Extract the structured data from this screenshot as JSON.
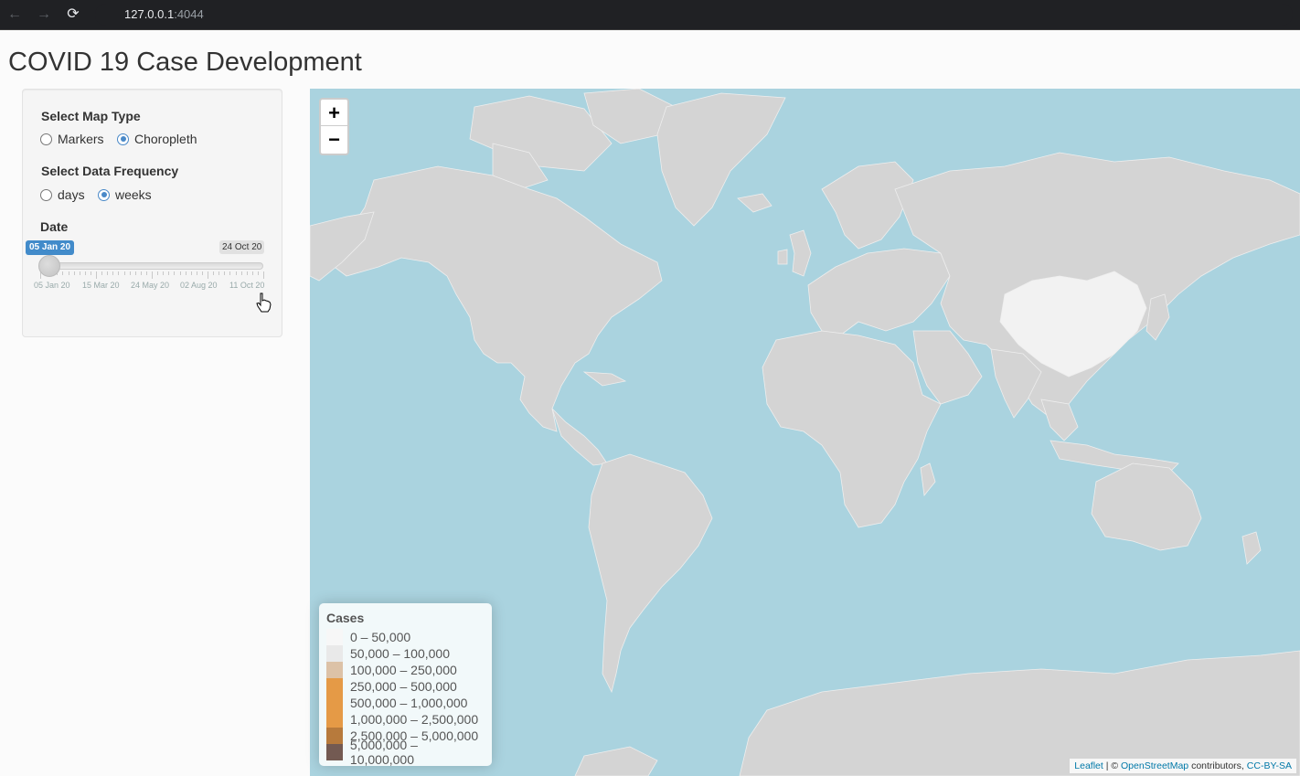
{
  "browser": {
    "url_host": "127.0.0.1",
    "url_port": ":4044"
  },
  "page": {
    "title": "COVID 19 Case Development"
  },
  "controls": {
    "map_type": {
      "label": "Select Map Type",
      "options": [
        "Markers",
        "Choropleth"
      ],
      "selected": "Choropleth"
    },
    "frequency": {
      "label": "Select Data Frequency",
      "options": [
        "days",
        "weeks"
      ],
      "selected": "weeks"
    },
    "date": {
      "label": "Date",
      "from_label": "05 Jan 20",
      "max_label": "24 Oct 20",
      "tick_labels": [
        "05 Jan 20",
        "15 Mar 20",
        "24 May 20",
        "02 Aug 20",
        "11 Oct 20"
      ],
      "position_fraction": 0
    }
  },
  "map": {
    "zoom_in": "+",
    "zoom_out": "−",
    "legend": {
      "title": "Cases",
      "items": [
        {
          "label": "0 – 50,000",
          "color": "#f7f7f7"
        },
        {
          "label": "50,000 – 100,000",
          "color": "#e9e9e9"
        },
        {
          "label": "100,000 – 250,000",
          "color": "#dcc2a7"
        },
        {
          "label": "250,000 – 500,000",
          "color": "#e59a46"
        },
        {
          "label": "500,000 – 1,000,000",
          "color": "#e59a46"
        },
        {
          "label": "1,000,000 – 2,500,000",
          "color": "#e59a46"
        },
        {
          "label": "2,500,000 – 5,000,000",
          "color": "#b77a3c"
        },
        {
          "label": "5,000,000 – 10,000,000",
          "color": "#735a52"
        }
      ]
    },
    "attribution": {
      "leaflet": "Leaflet",
      "sep": " | © ",
      "osm": "OpenStreetMap",
      "contrib": " contributors, ",
      "license": "CC-BY-SA"
    },
    "colors": {
      "water": "#aad3df",
      "land": "#d4d4d4",
      "highlight": "#f2f2f2"
    }
  }
}
